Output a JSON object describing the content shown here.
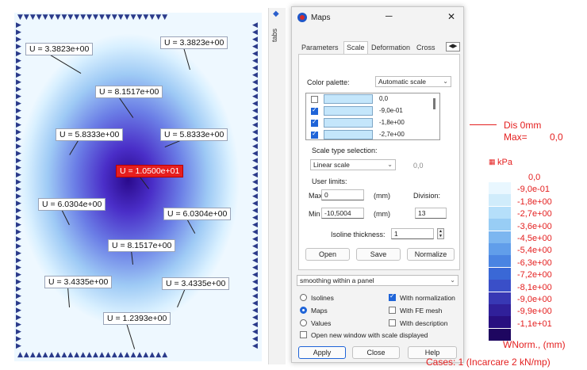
{
  "map": {
    "labels": [
      {
        "text": "U = 3.3823e+00",
        "red": false
      },
      {
        "text": "U = 3.3823e+00",
        "red": false
      },
      {
        "text": "U = 8.1517e+00",
        "red": false
      },
      {
        "text": "U = 5.8333e+00",
        "red": false
      },
      {
        "text": "U = 5.8333e+00",
        "red": false
      },
      {
        "text": "U = 1.0500e+01",
        "red": true
      },
      {
        "text": "U = 6.0304e+00",
        "red": false
      },
      {
        "text": "U = 6.0304e+00",
        "red": false
      },
      {
        "text": "U = 8.1517e+00",
        "red": false
      },
      {
        "text": "U = 3.4335e+00",
        "red": false
      },
      {
        "text": "U = 3.4335e+00",
        "red": false
      },
      {
        "text": "U = 1.2393e+00",
        "red": false
      }
    ],
    "colors": {
      "center": "#2a0a8c",
      "edge": "#eef8ff"
    }
  },
  "strip": {
    "label": "tabs"
  },
  "dialog": {
    "title": "Maps",
    "tabs": [
      "Parameters",
      "Scale",
      "Deformation",
      "Cross"
    ],
    "active_tab": "Scale",
    "color_palette_label": "Color palette:",
    "color_palette_value": "Automatic scale",
    "palette_rows": [
      {
        "value": "0,0",
        "checked": false
      },
      {
        "value": "-9,0e-01",
        "checked": true
      },
      {
        "value": "-1,8e+00",
        "checked": true
      },
      {
        "value": "-2,7e+00",
        "checked": true
      }
    ],
    "scale_type_label": "Scale type selection:",
    "scale_type_value": "Linear scale",
    "scale_factor": "0,0",
    "user_limits_label": "User limits:",
    "max_label": "Max",
    "max_value": "0",
    "min_label": "Min",
    "min_value": "-10,5004",
    "unit_label": "(mm)",
    "division_label": "Division:",
    "division_value": "13",
    "isoline_label": "Isoline thickness:",
    "isoline_value": "1",
    "open_label": "Open",
    "save_label": "Save",
    "normalize_label": "Normalize",
    "smoothing_value": "smoothing within a panel",
    "isolines_label": "Isolines",
    "maps_label": "Maps",
    "values_label": "Values",
    "with_normalization_label": "With normalization",
    "with_fe_mesh_label": "With FE mesh",
    "with_description_label": "With description",
    "open_new_window_label": "Open new window with scale displayed",
    "apply_label": "Apply",
    "close_label": "Close",
    "help_label": "Help",
    "selected_radio": "Maps",
    "with_normalization_checked": true
  },
  "legend": {
    "dis_title": "Dis  0mm",
    "max_label": "Max=",
    "max_value": "0,0",
    "kpa_label": "kPa",
    "values": [
      "0,0",
      "-9,0e-01",
      "-1,8e+00",
      "-2,7e+00",
      "-3,6e+00",
      "-4,5e+00",
      "-5,4e+00",
      "-6,3e+00",
      "-7,2e+00",
      "-8,1e+00",
      "-9,0e+00",
      "-9,9e+00",
      "-1,1e+01"
    ],
    "colors": [
      "#e9f7ff",
      "#d0ecfb",
      "#b5dffa",
      "#98cdf5",
      "#7cb6f0",
      "#619eea",
      "#4a84e2",
      "#3a68d6",
      "#3a4fc8",
      "#3838b4",
      "#30209a",
      "#280f80",
      "#1e0660"
    ],
    "norm_label": "WNorm., (mm)",
    "cases_label": "Cases: 1 (Incarcare 2 kN/mp)",
    "text_color": "#e42020"
  }
}
